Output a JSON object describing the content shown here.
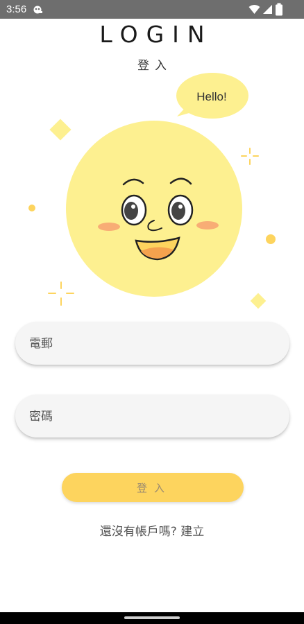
{
  "status_bar": {
    "time": "3:56",
    "icons": [
      "notification-icon",
      "wifi-icon",
      "signal-icon",
      "battery-icon"
    ]
  },
  "header": {
    "title": "LOGIN",
    "subtitle": "登入"
  },
  "illustration": {
    "speech_bubble": "Hello!",
    "face_color": "#fdf090",
    "accent_color": "#fdd45e"
  },
  "form": {
    "email_placeholder": "電郵",
    "password_placeholder": "密碼",
    "email_value": "",
    "password_value": ""
  },
  "login_button": {
    "label": "登入"
  },
  "register": {
    "prompt": "還沒有帳戶嗎?",
    "link": "建立"
  },
  "colors": {
    "accent": "#fdd45e",
    "status_bar": "#6e6e6e",
    "field_background": "#f5f5f5"
  }
}
